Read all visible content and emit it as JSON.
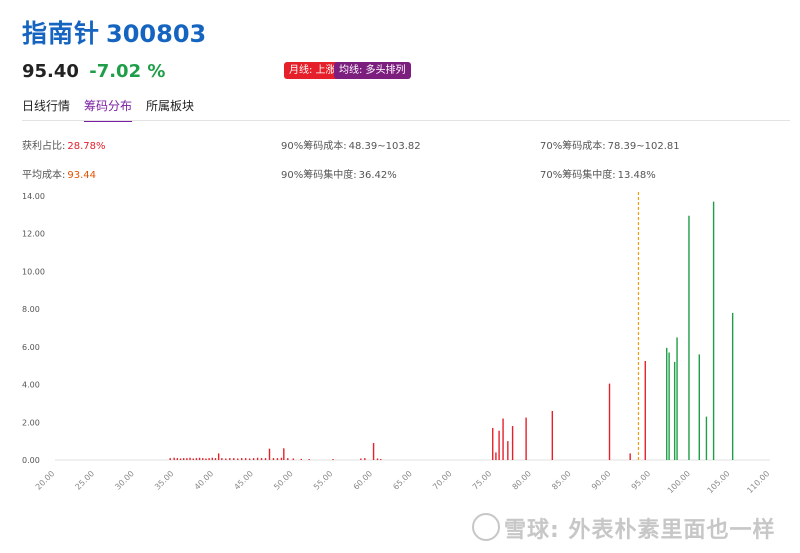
{
  "header": {
    "name": "指南针",
    "code": "300803",
    "price": "95.40",
    "change": "-7.02 %",
    "badge_month": "月线: 上涨",
    "badge_ma": "均线: 多头排列"
  },
  "tabs": [
    {
      "label": "日线行情",
      "active": false
    },
    {
      "label": "筹码分布",
      "active": true
    },
    {
      "label": "所属板块",
      "active": false
    }
  ],
  "stats": {
    "profit_ratio_label": "获利占比:",
    "profit_ratio_value": "28.78%",
    "avg_cost_label": "平均成本:",
    "avg_cost_value": "93.44",
    "cost90_label": "90%筹码成本:",
    "cost90_value": "48.39~103.82",
    "conc90_label": "90%筹码集中度:",
    "conc90_value": "36.42%",
    "cost70_label": "70%筹码成本:",
    "cost70_value": "78.39~102.81",
    "conc70_label": "70%筹码集中度:",
    "conc70_value": "13.48%"
  },
  "chart_data": {
    "type": "bar",
    "xlim": [
      20,
      110
    ],
    "ylim": [
      0,
      14
    ],
    "xticks": [
      "20.00",
      "25.00",
      "30.00",
      "35.00",
      "40.00",
      "45.00",
      "50.00",
      "55.00",
      "60.00",
      "65.00",
      "70.00",
      "75.00",
      "80.00",
      "85.00",
      "90.00",
      "95.00",
      "100.00",
      "105.00",
      "110.00"
    ],
    "xtick_values": [
      20,
      25,
      30,
      35,
      40,
      45,
      50,
      55,
      60,
      65,
      70,
      75,
      80,
      85,
      90,
      95,
      100,
      105,
      110
    ],
    "yticks": [
      "0.00",
      "2.00",
      "4.00",
      "6.00",
      "8.00",
      "10.00",
      "12.00",
      "14.00"
    ],
    "ytick_values": [
      0,
      2,
      4,
      6,
      8,
      10,
      12,
      14
    ],
    "avg_cost_line": 93.44,
    "current_price": 95.4,
    "colors": {
      "profit": "#e5202a",
      "loss": "#1e9e48",
      "avg_line": "#f39c12",
      "axis": "#e0e0e0",
      "tick": "#888888"
    },
    "series": [
      {
        "values": [
          [
            34.5,
            0.1
          ],
          [
            35.0,
            0.12
          ],
          [
            35.4,
            0.1
          ],
          [
            35.8,
            0.08
          ],
          [
            36.2,
            0.1
          ],
          [
            36.6,
            0.1
          ],
          [
            37.0,
            0.12
          ],
          [
            37.4,
            0.08
          ],
          [
            37.8,
            0.1
          ],
          [
            38.2,
            0.12
          ],
          [
            38.6,
            0.1
          ],
          [
            39.0,
            0.08
          ],
          [
            39.4,
            0.1
          ],
          [
            39.8,
            0.12
          ],
          [
            40.2,
            0.1
          ],
          [
            40.6,
            0.35
          ],
          [
            41.0,
            0.1
          ],
          [
            41.5,
            0.08
          ],
          [
            42.0,
            0.1
          ],
          [
            42.5,
            0.1
          ],
          [
            43.0,
            0.08
          ],
          [
            43.5,
            0.1
          ],
          [
            44.0,
            0.1
          ],
          [
            44.5,
            0.08
          ],
          [
            45.0,
            0.1
          ],
          [
            45.5,
            0.12
          ],
          [
            46.0,
            0.1
          ],
          [
            46.5,
            0.1
          ],
          [
            47.0,
            0.6
          ],
          [
            47.5,
            0.1
          ],
          [
            48.0,
            0.1
          ],
          [
            48.5,
            0.12
          ],
          [
            48.8,
            0.62
          ],
          [
            49.3,
            0.1
          ],
          [
            50.0,
            0.08
          ],
          [
            51.0,
            0.06
          ],
          [
            52.0,
            0.05
          ],
          [
            55.0,
            0.05
          ],
          [
            58.5,
            0.08
          ],
          [
            59.0,
            0.1
          ],
          [
            60.1,
            0.9
          ],
          [
            60.6,
            0.08
          ],
          [
            61.0,
            0.05
          ],
          [
            75.1,
            1.7
          ],
          [
            75.5,
            0.4
          ],
          [
            75.9,
            1.55
          ],
          [
            76.4,
            2.2
          ],
          [
            77.0,
            1.0
          ],
          [
            77.6,
            1.8
          ],
          [
            79.3,
            2.25
          ],
          [
            82.6,
            2.6
          ],
          [
            89.8,
            4.05
          ],
          [
            92.4,
            0.35
          ],
          [
            94.3,
            5.25
          ]
        ]
      },
      {
        "values": [
          [
            97.0,
            5.95
          ],
          [
            97.3,
            5.7
          ],
          [
            98.0,
            5.2
          ],
          [
            98.3,
            6.5
          ],
          [
            99.8,
            12.95
          ],
          [
            101.1,
            5.6
          ],
          [
            102.0,
            2.3
          ],
          [
            102.9,
            13.7
          ],
          [
            105.3,
            7.8
          ]
        ]
      }
    ]
  },
  "watermark": "雪球: 外表朴素里面也一样"
}
